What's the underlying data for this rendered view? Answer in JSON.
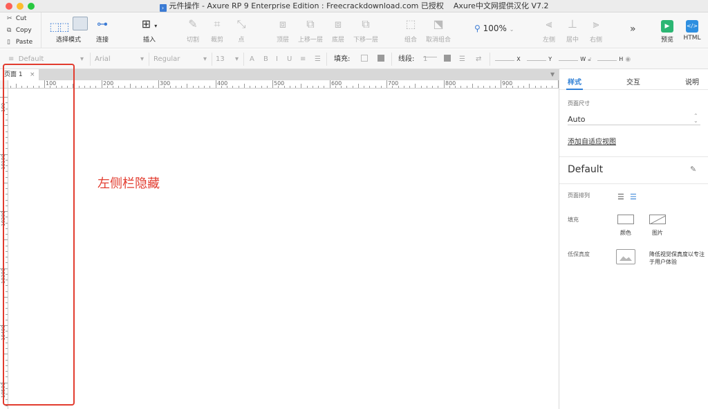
{
  "window": {
    "title": "元件操作 - Axure RP 9 Enterprise Edition : Freecrackdownload.com 已授权",
    "subtitle": "Axure中文网提供汉化 V7.2"
  },
  "clipboard": {
    "cut": "Cut",
    "copy": "Copy",
    "paste": "Paste"
  },
  "toolbar": {
    "select_mode": "选择模式",
    "connect": "连接",
    "insert": "插入",
    "cut": "切割",
    "crop": "裁剪",
    "point": "点",
    "top": "顶层",
    "move_up": "上移一层",
    "bottom": "底层",
    "move_down": "下移一层",
    "group": "组合",
    "ungroup": "取消组合",
    "zoom": "100%",
    "align_left": "左侧",
    "align_center": "居中",
    "align_right": "右侧",
    "preview": "预览",
    "html": "HTML"
  },
  "formatbar": {
    "style": "Default",
    "font": "Arial",
    "weight": "Regular",
    "size": "13",
    "fill_label": "填充:",
    "stroke_label": "线段:",
    "stroke_value": "1",
    "x": "X",
    "y": "Y",
    "w": "W",
    "h": "H"
  },
  "tabs": [
    {
      "label": "页面 1"
    }
  ],
  "ruler": {
    "h_labels": [
      "100",
      "200",
      "300",
      "400",
      "500",
      "600",
      "700",
      "800",
      "900"
    ],
    "v_labels": [
      "100",
      "10100",
      "10200",
      "10300",
      "10400",
      "10500"
    ]
  },
  "annotation": {
    "text": "左侧栏隐藏",
    "color": "#e23b2e"
  },
  "right_panel": {
    "tabs": [
      "样式",
      "交互",
      "说明"
    ],
    "active_tab": "样式",
    "page_size_label": "页面尺寸",
    "page_size_value": "Auto",
    "adaptive_link": "添加自适应视图",
    "style_name": "Default",
    "page_align_label": "页面排列",
    "fill_label": "填充",
    "color_label": "颜色",
    "image_label": "图片",
    "lofi_label": "低保真度",
    "lofi_desc": "降低视觉保真度以专注于用户体验"
  },
  "colors": {
    "accent": "#2f7fd6",
    "preview": "#2bb673",
    "html": "#2e8fe0"
  }
}
